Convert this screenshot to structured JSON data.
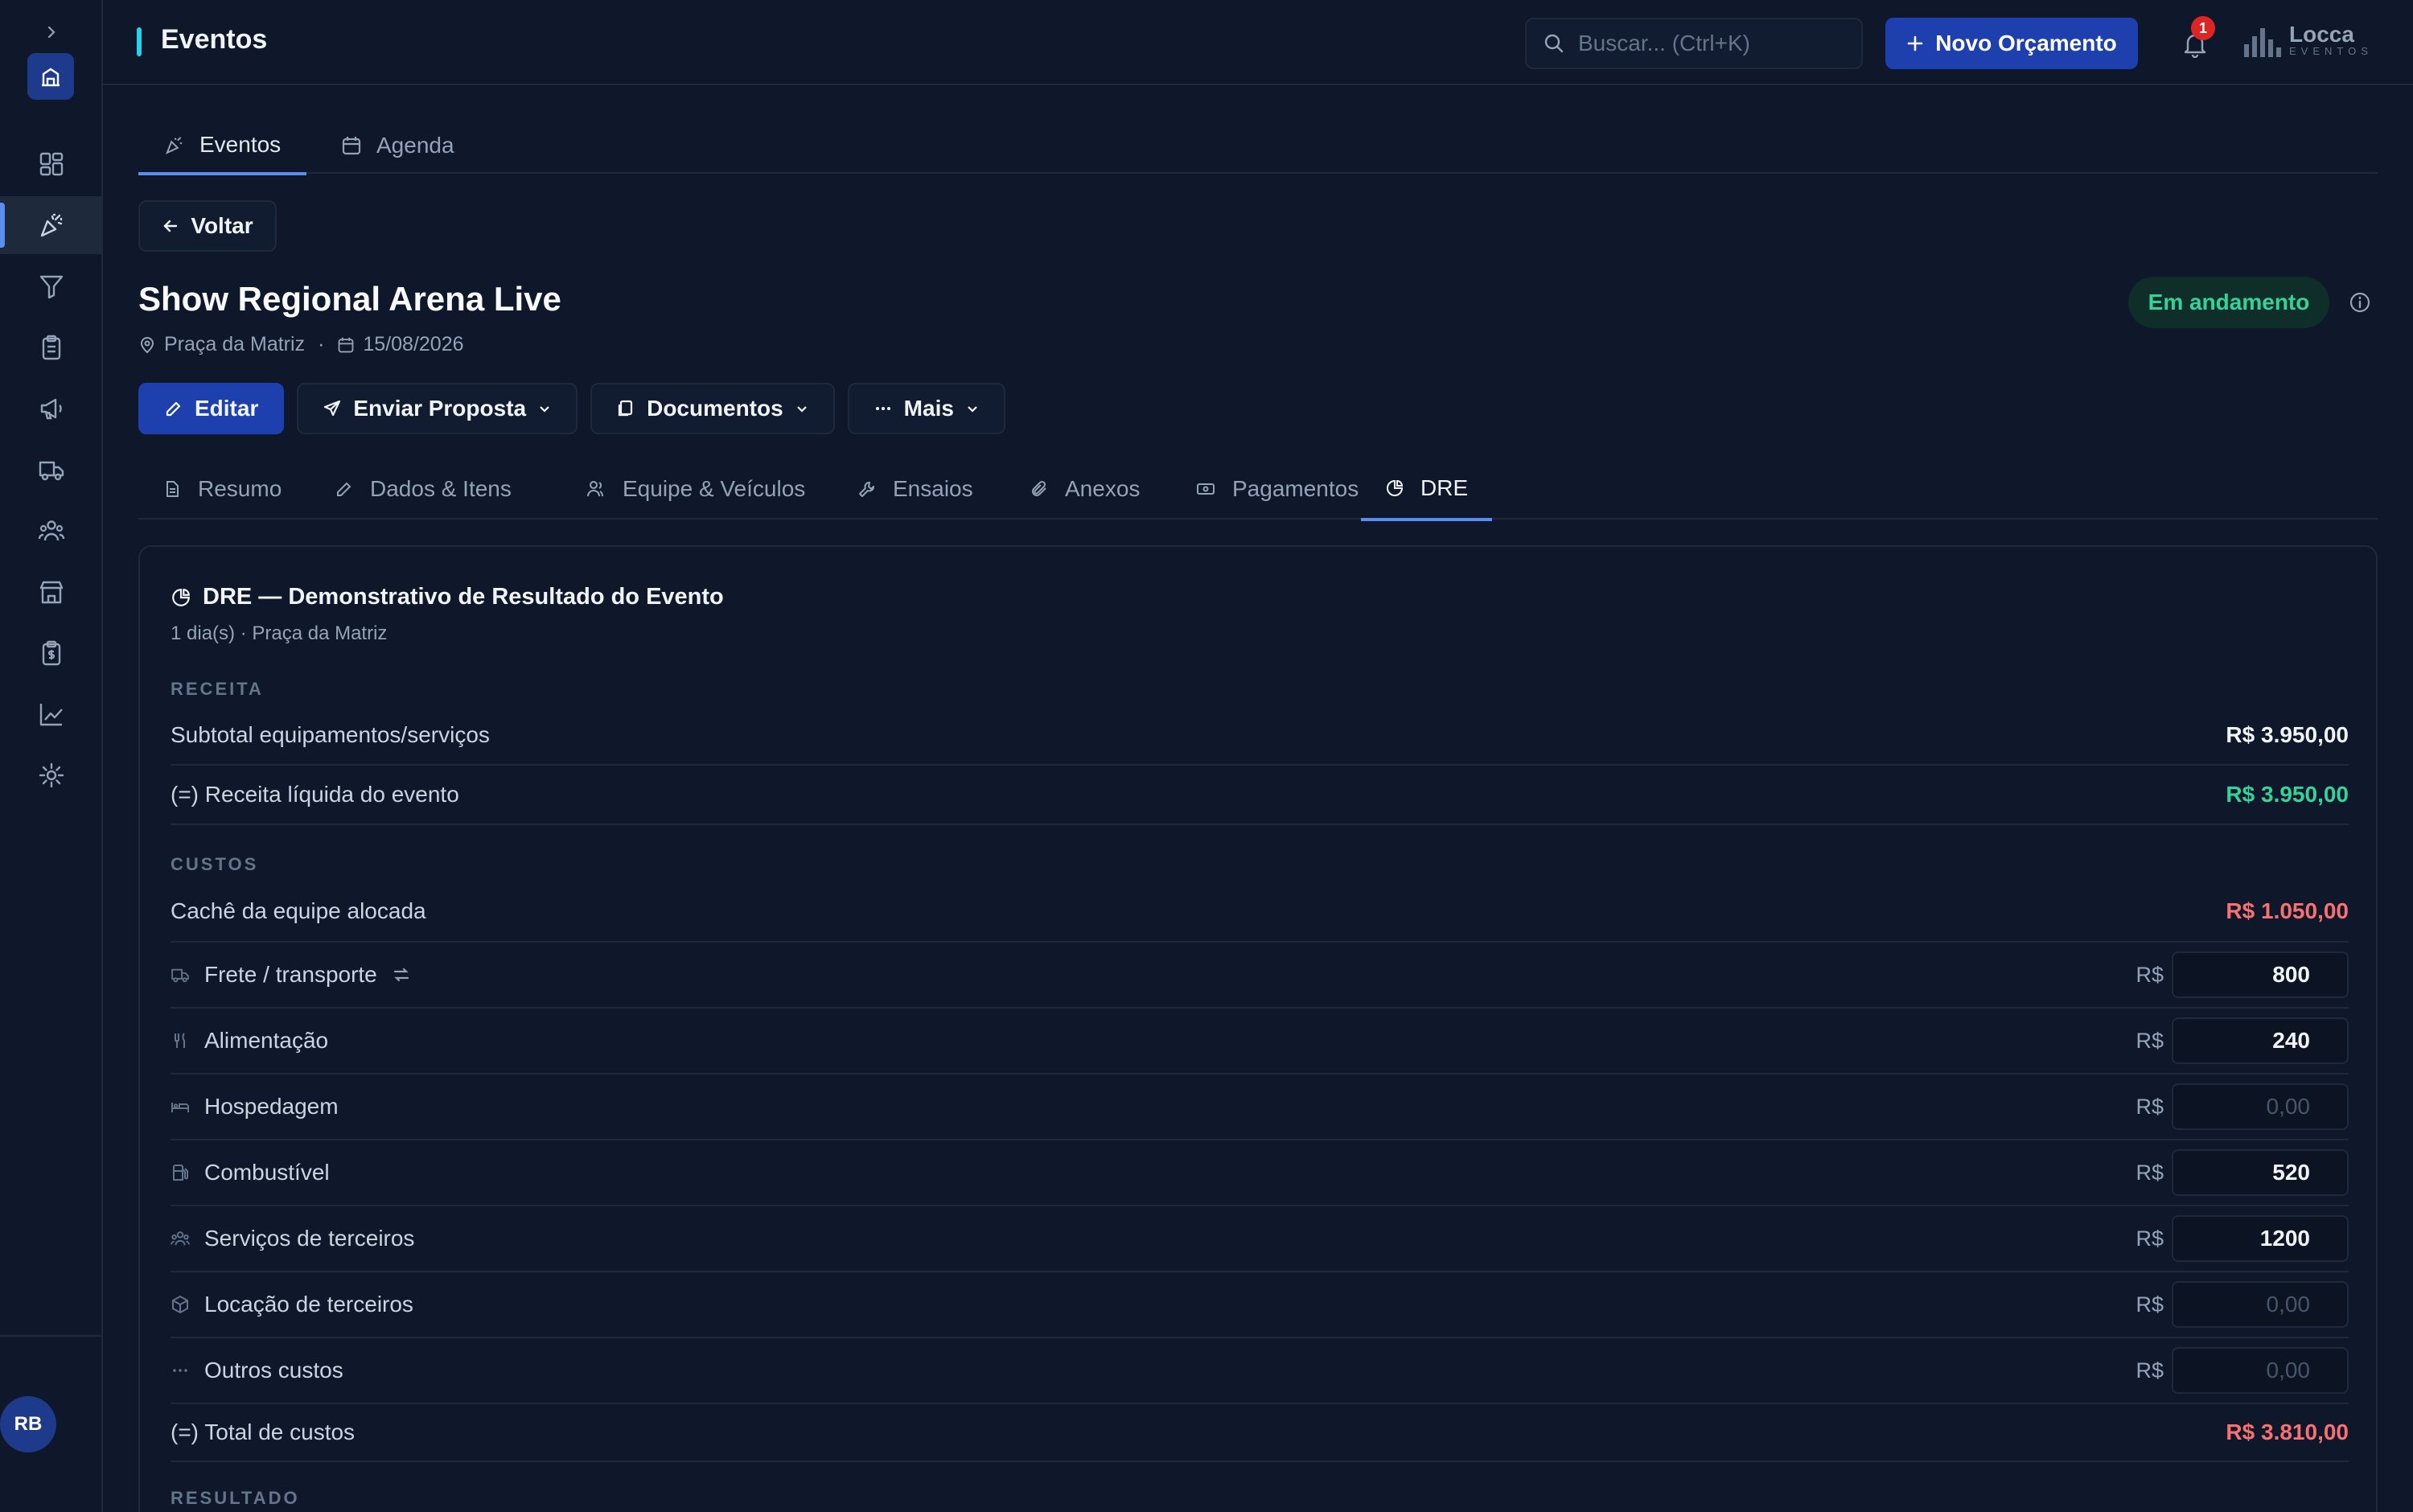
{
  "header": {
    "title": "Eventos",
    "search_placeholder": "Buscar... (Ctrl+K)",
    "new_button": "Novo Orçamento",
    "notifications_count": "1",
    "brand_name": "Locca",
    "brand_sub": "EVENTOS"
  },
  "user": {
    "initials": "RB"
  },
  "page_tabs": [
    {
      "label": "Eventos"
    },
    {
      "label": "Agenda"
    }
  ],
  "back_label": "Voltar",
  "event": {
    "title": "Show Regional Arena Live",
    "location": "Praça da Matriz",
    "date": "15/08/2026",
    "status": "Em andamento"
  },
  "actions": {
    "edit": "Editar",
    "send": "Enviar Proposta",
    "docs": "Documentos",
    "more": "Mais"
  },
  "sections": [
    {
      "label": "Resumo"
    },
    {
      "label": "Dados & Itens"
    },
    {
      "label": "Equipe & Veículos"
    },
    {
      "label": "Ensaios"
    },
    {
      "label": "Anexos"
    },
    {
      "label": "Pagamentos"
    },
    {
      "label": "DRE"
    }
  ],
  "dre": {
    "title": "DRE — Demonstrativo de Resultado do Evento",
    "subtitle": "1 dia(s) · Praça da Matriz",
    "revenue_label": "RECEITA",
    "revenue": [
      {
        "label": "Subtotal equipamentos/serviços",
        "value": "R$ 3.950,00"
      },
      {
        "label": "(=) Receita líquida do evento",
        "value": "R$ 3.950,00"
      }
    ],
    "costs_label": "CUSTOS",
    "crew_cost": {
      "label": "Cachê da equipe alocada",
      "value": "R$ 1.050,00"
    },
    "currency": "R$",
    "cost_items": [
      {
        "label": "Frete / transporte",
        "value": "800",
        "placeholder": "0,00"
      },
      {
        "label": "Alimentação",
        "value": "240",
        "placeholder": "0,00"
      },
      {
        "label": "Hospedagem",
        "value": "",
        "placeholder": "0,00"
      },
      {
        "label": "Combustível",
        "value": "520",
        "placeholder": "0,00"
      },
      {
        "label": "Serviços de terceiros",
        "value": "1200",
        "placeholder": "0,00"
      },
      {
        "label": "Locação de terceiros",
        "value": "",
        "placeholder": "0,00"
      },
      {
        "label": "Outros custos",
        "value": "",
        "placeholder": "0,00"
      }
    ],
    "total_costs": {
      "label": "(=) Total de custos",
      "value": "R$ 3.810,00"
    },
    "result_label": "RESULTADO"
  }
}
